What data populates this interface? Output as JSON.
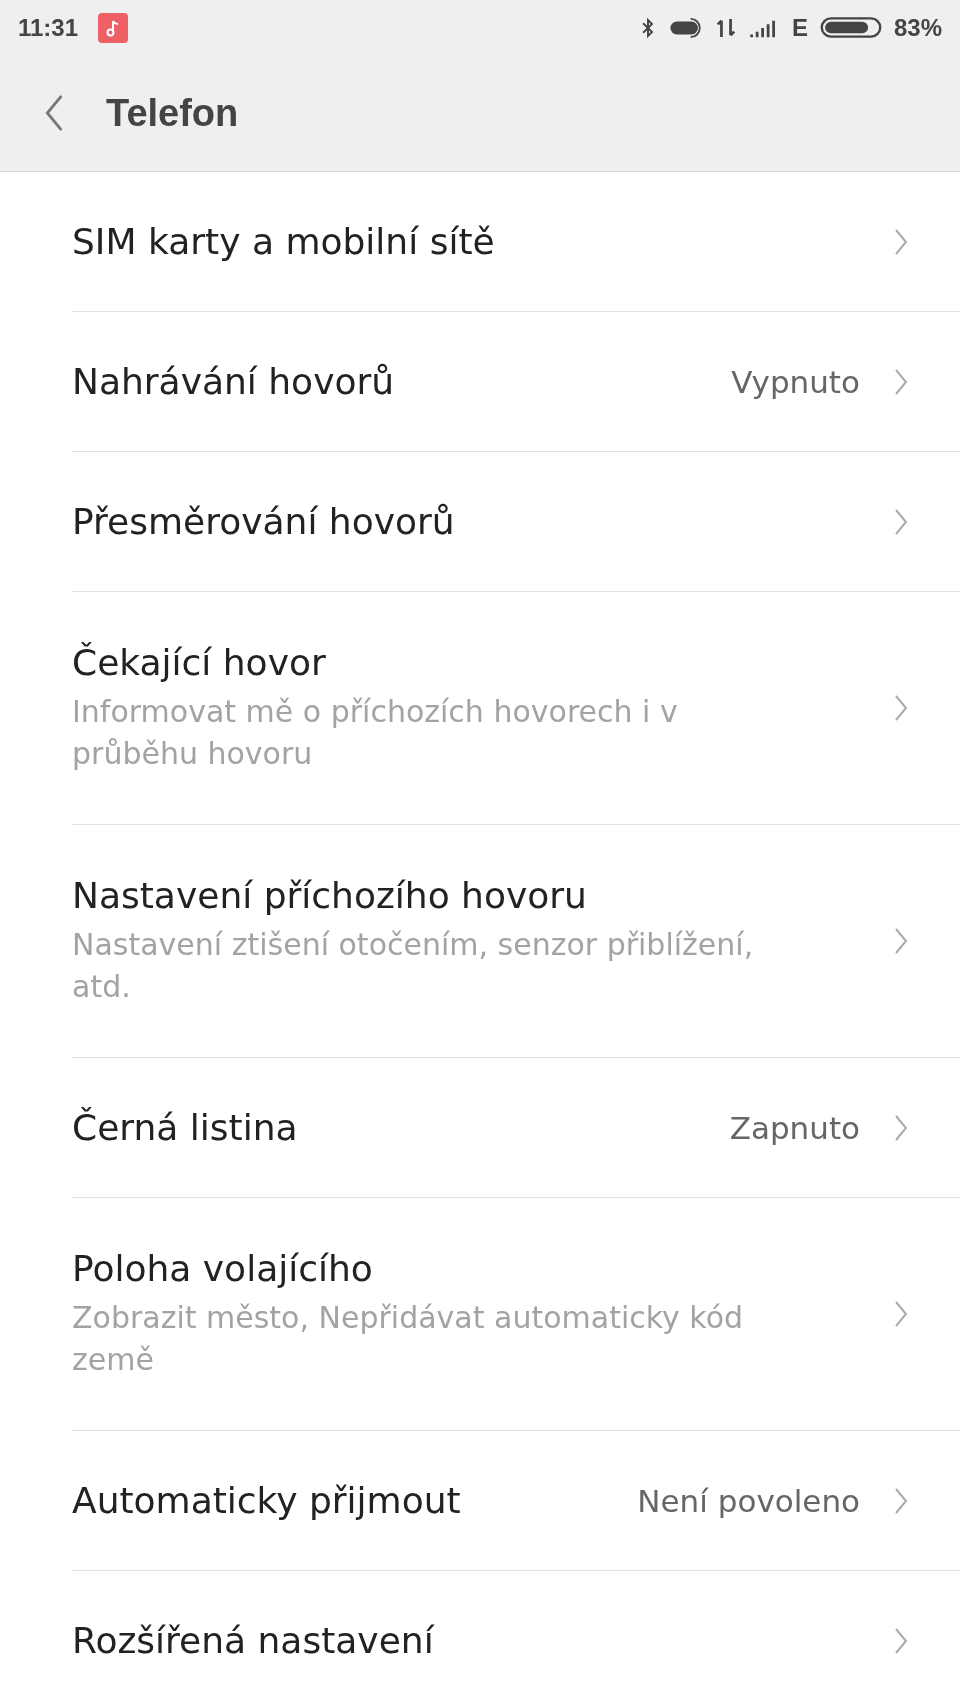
{
  "status_bar": {
    "time": "11:31",
    "network": "E",
    "battery": "83%",
    "battery_icon": {
      "level": 0.83
    }
  },
  "header": {
    "title": "Telefon"
  },
  "items": [
    {
      "title": "SIM karty a mobilní sítě"
    },
    {
      "title": "Nahrávání hovorů",
      "value": "Vypnuto"
    },
    {
      "title": "Přesměrování hovorů"
    },
    {
      "title": "Čekající hovor",
      "subtitle": "Informovat mě o příchozích hovorech i v průběhu hovoru"
    },
    {
      "title": "Nastavení příchozího hovoru",
      "subtitle": "Nastavení ztišení otočením, senzor přiblížení, atd."
    },
    {
      "title": "Černá listina",
      "value": "Zapnuto"
    },
    {
      "title": "Poloha volajícího",
      "subtitle": "Zobrazit město, Nepřidávat automaticky kód země"
    },
    {
      "title": "Automaticky přijmout",
      "value": "Není povoleno"
    },
    {
      "title": "Rozšířená nastavení"
    }
  ]
}
